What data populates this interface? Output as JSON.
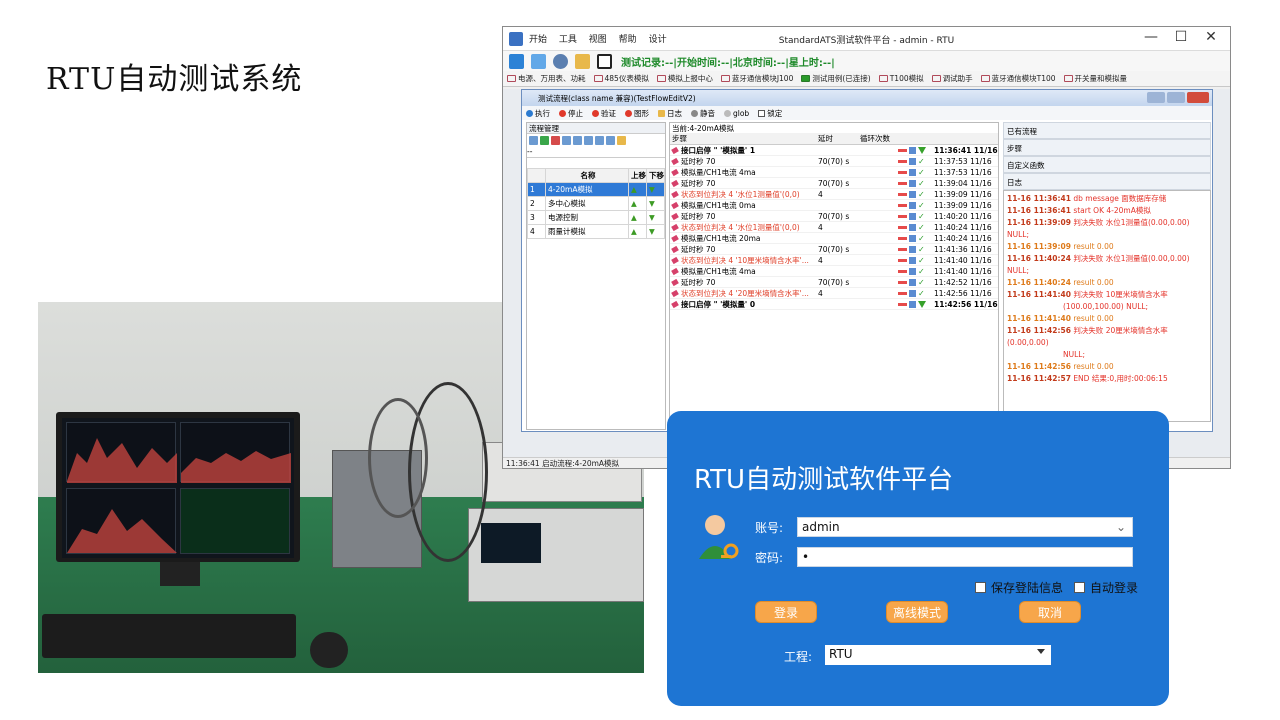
{
  "slide": {
    "title": "RTU自动测试系统"
  },
  "app": {
    "menu": [
      "开始",
      "工具",
      "视图",
      "帮助",
      "设计"
    ],
    "window_title": "StandardATS测试软件平台 - admin - RTU",
    "status_record": "测试记录:--|开始时间:--|北京时间:--|星上时:--|",
    "tabs": [
      "电源、万用表、功耗",
      "485仪表模拟",
      "模拟上报中心",
      "蓝牙通信模块J100",
      "测试用例(已连接)",
      "T100模拟",
      "调试助手",
      "蓝牙通信模块T100",
      "开关量和模拟量"
    ],
    "active_tab": "测试用例(已连接)",
    "statusbar": "11:36:41 启动流程:4-20mA模拟",
    "colors": {
      "accent": "#2f7ad6",
      "status_green": "#1e8a2a",
      "log_red": "#e4332a"
    }
  },
  "flow": {
    "title": "测试流程(class name 兼容)(TestFlowEditV2)",
    "toolbar": {
      "run": "执行",
      "stop": "停止",
      "verify": "验证",
      "graph": "图形",
      "log": "日志",
      "mute": "静音",
      "glob": "glob",
      "lock": "锁定"
    },
    "left": {
      "header": "流程管理",
      "dropdown": "--",
      "columns": [
        "名称",
        "上移",
        "下移"
      ],
      "rows": [
        {
          "idx": "1",
          "name": "4-20mA模拟"
        },
        {
          "idx": "2",
          "name": "多中心模拟"
        },
        {
          "idx": "3",
          "name": "电源控制"
        },
        {
          "idx": "4",
          "name": "雨量计模拟"
        }
      ]
    },
    "current": "当前:4-20mA模拟",
    "columns": {
      "step": "步骤",
      "delay": "延时",
      "loop": "循环次数"
    },
    "steps": [
      {
        "step": "接口启停 \" '模拟量' 1",
        "delay": "",
        "loop": "",
        "time": "11:36:41 11/16",
        "style": "bold",
        "icon": "arrow"
      },
      {
        "step": "延时秒 70",
        "delay": "70(70) s",
        "loop": "",
        "time": "11:37:53 11/16",
        "style": "",
        "icon": "check"
      },
      {
        "step": "模拟量/CH1电流 4ma",
        "delay": "",
        "loop": "",
        "time": "11:37:53 11/16",
        "style": "",
        "icon": "check"
      },
      {
        "step": "延时秒 70",
        "delay": "70(70) s",
        "loop": "",
        "time": "11:39:04 11/16",
        "style": "",
        "icon": "check"
      },
      {
        "step": "状态到位判决 4 '水位1测量值'(0,0)",
        "delay": "4",
        "loop": "",
        "time": "11:39:09 11/16",
        "style": "red",
        "icon": "check"
      },
      {
        "step": "模拟量/CH1电流 0ma",
        "delay": "",
        "loop": "",
        "time": "11:39:09 11/16",
        "style": "",
        "icon": "check"
      },
      {
        "step": "延时秒 70",
        "delay": "70(70) s",
        "loop": "",
        "time": "11:40:20 11/16",
        "style": "",
        "icon": "check"
      },
      {
        "step": "状态到位判决 4 '水位1测量值'(0,0)",
        "delay": "4",
        "loop": "",
        "time": "11:40:24 11/16",
        "style": "red",
        "icon": "check"
      },
      {
        "step": "模拟量/CH1电流 20ma",
        "delay": "",
        "loop": "",
        "time": "11:40:24 11/16",
        "style": "",
        "icon": "check"
      },
      {
        "step": "延时秒 70",
        "delay": "70(70) s",
        "loop": "",
        "time": "11:41:36 11/16",
        "style": "",
        "icon": "check"
      },
      {
        "step": "状态到位判决 4 '10厘米墒情含水率'...",
        "delay": "4",
        "loop": "",
        "time": "11:41:40 11/16",
        "style": "red",
        "icon": "check"
      },
      {
        "step": "模拟量/CH1电流 4ma",
        "delay": "",
        "loop": "",
        "time": "11:41:40 11/16",
        "style": "",
        "icon": "check"
      },
      {
        "step": "延时秒 70",
        "delay": "70(70) s",
        "loop": "",
        "time": "11:42:52 11/16",
        "style": "",
        "icon": "check"
      },
      {
        "step": "状态到位判决 4 '20厘米墒情含水率'...",
        "delay": "4",
        "loop": "",
        "time": "11:42:56 11/16",
        "style": "red",
        "icon": "check"
      },
      {
        "step": "接口启停 \" '模拟量' 0",
        "delay": "",
        "loop": "",
        "time": "11:42:56 11/16",
        "style": "bold",
        "icon": "arrow"
      }
    ],
    "right": {
      "sections": [
        "已有流程",
        "步骤",
        "自定义函数",
        "日志"
      ],
      "log": [
        {
          "ts": "11-16 11:36:41",
          "msg": "db message 面数据库存储",
          "style": "dark"
        },
        {
          "ts": "11-16 11:36:41",
          "msg": "start OK 4-20mA模拟",
          "style": "dark"
        },
        {
          "ts": "11-16 11:39:09",
          "msg": "判决失败 水位1测量值(0.00,0.00) NULL;",
          "style": "dark"
        },
        {
          "ts": "11-16 11:39:09",
          "msg": "result 0.00",
          "style": "orange"
        },
        {
          "ts": "11-16 11:40:24",
          "msg": "判决失败 水位1测量值(0.00,0.00) NULL;",
          "style": "dark"
        },
        {
          "ts": "11-16 11:40:24",
          "msg": "result 0.00",
          "style": "orange"
        },
        {
          "ts": "11-16 11:41:40",
          "msg": "判决失败 10厘米墒情含水率",
          "style": "dark"
        },
        {
          "ts": "",
          "msg": "(100.00,100.00) NULL;",
          "style": "dark"
        },
        {
          "ts": "11-16 11:41:40",
          "msg": "result 0.00",
          "style": "orange"
        },
        {
          "ts": "11-16 11:42:56",
          "msg": "判决失败 20厘米墒情含水率(0.00,0.00)",
          "style": "dark"
        },
        {
          "ts": "",
          "msg": "NULL;",
          "style": "dark"
        },
        {
          "ts": "11-16 11:42:56",
          "msg": "result 0.00",
          "style": "orange"
        },
        {
          "ts": "11-16 11:42:57",
          "msg": "END 结果:0,用时:00:06:15",
          "style": "dark"
        }
      ]
    }
  },
  "login": {
    "title": "RTU自动测试软件平台",
    "account_label": "账号:",
    "account_value": "admin",
    "password_label": "密码:",
    "password_value": "•",
    "save_login": "保存登陆信息",
    "auto_login": "自动登录",
    "login_button": "登录",
    "offline_button": "离线模式",
    "cancel_button": "取消",
    "project_label": "工程:",
    "project_value": "RTU"
  }
}
